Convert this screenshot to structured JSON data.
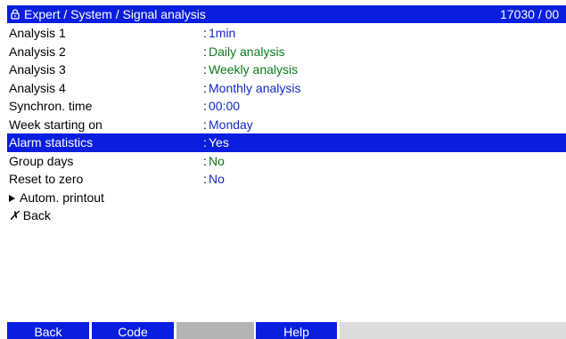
{
  "titlebar": {
    "icon": "lock-icon",
    "path": "Expert / System / Signal analysis",
    "code": "17030 / 00"
  },
  "rows": [
    {
      "label": "Analysis 1",
      "value": "1min",
      "value_color": "#1428c8"
    },
    {
      "label": "Analysis 2",
      "value": "Daily analysis",
      "value_color": "#0a7a1a"
    },
    {
      "label": "Analysis 3",
      "value": "Weekly analysis",
      "value_color": "#0a7a1a"
    },
    {
      "label": "Analysis 4",
      "value": "Monthly analysis",
      "value_color": "#1428c8"
    },
    {
      "label": "Synchron. time",
      "value": "00:00",
      "value_color": "#1428c8"
    },
    {
      "label": "Week starting on",
      "value": "Monday",
      "value_color": "#1428c8"
    },
    {
      "label": "Alarm statistics",
      "value": "Yes",
      "value_color": "#ffffff",
      "selected": true
    },
    {
      "label": "Group days",
      "value": "No",
      "value_color": "#0a7a1a"
    },
    {
      "label": "Reset to zero",
      "value": "No",
      "value_color": "#1428c8"
    }
  ],
  "colon": ":",
  "submenu": {
    "icon": "triangle-right-icon",
    "label": "Autom. printout"
  },
  "back_item": {
    "icon": "x-icon",
    "glyph": "✗",
    "label": "Back"
  },
  "softkeys": {
    "back": "Back",
    "code": "Code",
    "help": "Help"
  },
  "colors": {
    "accent": "#0a1ee0",
    "value_blue": "#1428c8",
    "value_green": "#0a7a1a",
    "softkey_empty": "#b4b4b4",
    "softkey_rest": "#dcdcdc"
  }
}
